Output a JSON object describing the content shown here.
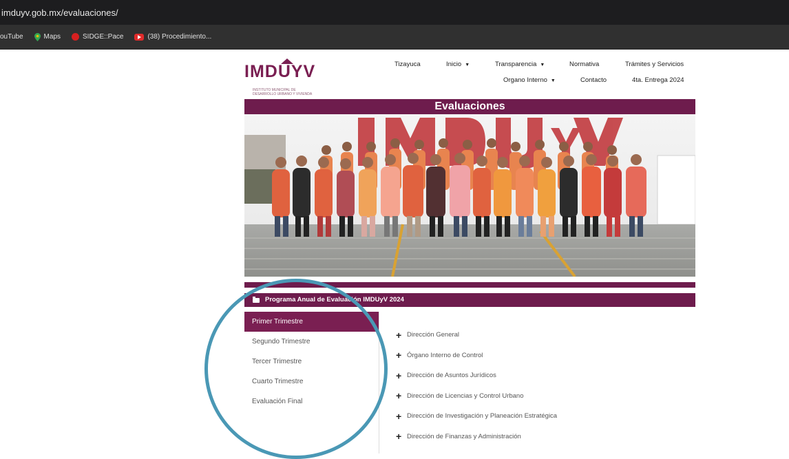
{
  "browser": {
    "url": "imduyv.gob.mx/evaluaciones/",
    "bookmarks": [
      {
        "label": "ouTube",
        "icon": "youtube-icon"
      },
      {
        "label": "Maps",
        "icon": "maps-pin-icon"
      },
      {
        "label": "SIDGE::Pace",
        "icon": "red-circle-icon"
      },
      {
        "label": "(38) Procedimiento...",
        "icon": "youtube-icon"
      }
    ]
  },
  "site": {
    "logo": "IMDUYV",
    "logo_subtitle": "Instituto Municipal de Desarrollo Urbano y Vivienda",
    "nav": {
      "tizayuca": "Tizayuca",
      "inicio": "Inicio",
      "transparencia": "Transparencia",
      "normativa": "Normativa",
      "tramites": "Trámites y Servicios",
      "organo": "Organo Interno",
      "contacto": "Contacto",
      "entrega": "4ta. Entrega 2024"
    },
    "page_title": "Evaluaciones",
    "hero_sign": "IMDUyV",
    "program_title": "Programa Anual de Evaluación IMDUyV 2024",
    "tabs": [
      "Primer Trimestre",
      "Segundo Trimestre",
      "Tercer Trimestre",
      "Cuarto Trimestre",
      "Evaluación Final"
    ],
    "active_tab": 0,
    "directions": [
      "Dirección General",
      "Órgano Interno de Control",
      "Dirección de Asuntos Jurídicos",
      "Dirección de Licencias y Control Urbano",
      "Dirección de Investigación y Planeación Estratégica",
      "Dirección de Finanzas y Administración"
    ]
  },
  "colors": {
    "brand": "#6e1c4d",
    "annotation_circle": "#4a98b5"
  }
}
